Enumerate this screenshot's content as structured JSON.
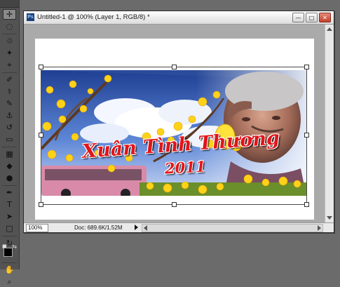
{
  "document": {
    "title": "Untitled-1 @ 100% (Layer 1, RGB/8) *",
    "app_badge": "Ps",
    "window_buttons": {
      "minimize": "—",
      "restore": "□",
      "close": "✕"
    }
  },
  "artwork": {
    "caption_line1": "Xuân Tình Thương",
    "caption_line2": "2011"
  },
  "statusbar": {
    "zoom": "100%",
    "doc_info": "Doc: 689.6K/1.52M"
  },
  "tools": [
    {
      "name": "move-tool-icon",
      "glyph": "✛"
    },
    {
      "name": "marquee-tool-icon",
      "glyph": "◌"
    },
    {
      "name": "lasso-tool-icon",
      "glyph": "♲"
    },
    {
      "name": "quick-selection-tool-icon",
      "glyph": "✦"
    },
    {
      "name": "crop-tool-icon",
      "glyph": "⌖"
    },
    {
      "name": "eyedropper-tool-icon",
      "glyph": "✐"
    },
    {
      "name": "healing-brush-tool-icon",
      "glyph": "⚕"
    },
    {
      "name": "brush-tool-icon",
      "glyph": "✎"
    },
    {
      "name": "clone-stamp-tool-icon",
      "glyph": "⚓"
    },
    {
      "name": "history-brush-tool-icon",
      "glyph": "↺"
    },
    {
      "name": "eraser-tool-icon",
      "glyph": "▭"
    },
    {
      "name": "gradient-tool-icon",
      "glyph": "▦"
    },
    {
      "name": "blur-tool-icon",
      "glyph": "◆"
    },
    {
      "name": "dodge-tool-icon",
      "glyph": "●"
    },
    {
      "name": "pen-tool-icon",
      "glyph": "✒"
    },
    {
      "name": "type-tool-icon",
      "glyph": "T"
    },
    {
      "name": "path-selection-tool-icon",
      "glyph": "➤"
    },
    {
      "name": "shape-tool-icon",
      "glyph": "□"
    },
    {
      "name": "3d-rotate-tool-icon",
      "glyph": "↻"
    },
    {
      "name": "3d-orbit-tool-icon",
      "glyph": "⟳"
    },
    {
      "name": "hand-tool-icon",
      "glyph": "✋"
    },
    {
      "name": "zoom-tool-icon",
      "glyph": "⌕"
    }
  ],
  "colors": {
    "foreground": "#000000",
    "background": "#ffffff",
    "caption_red": "#e2141a"
  }
}
